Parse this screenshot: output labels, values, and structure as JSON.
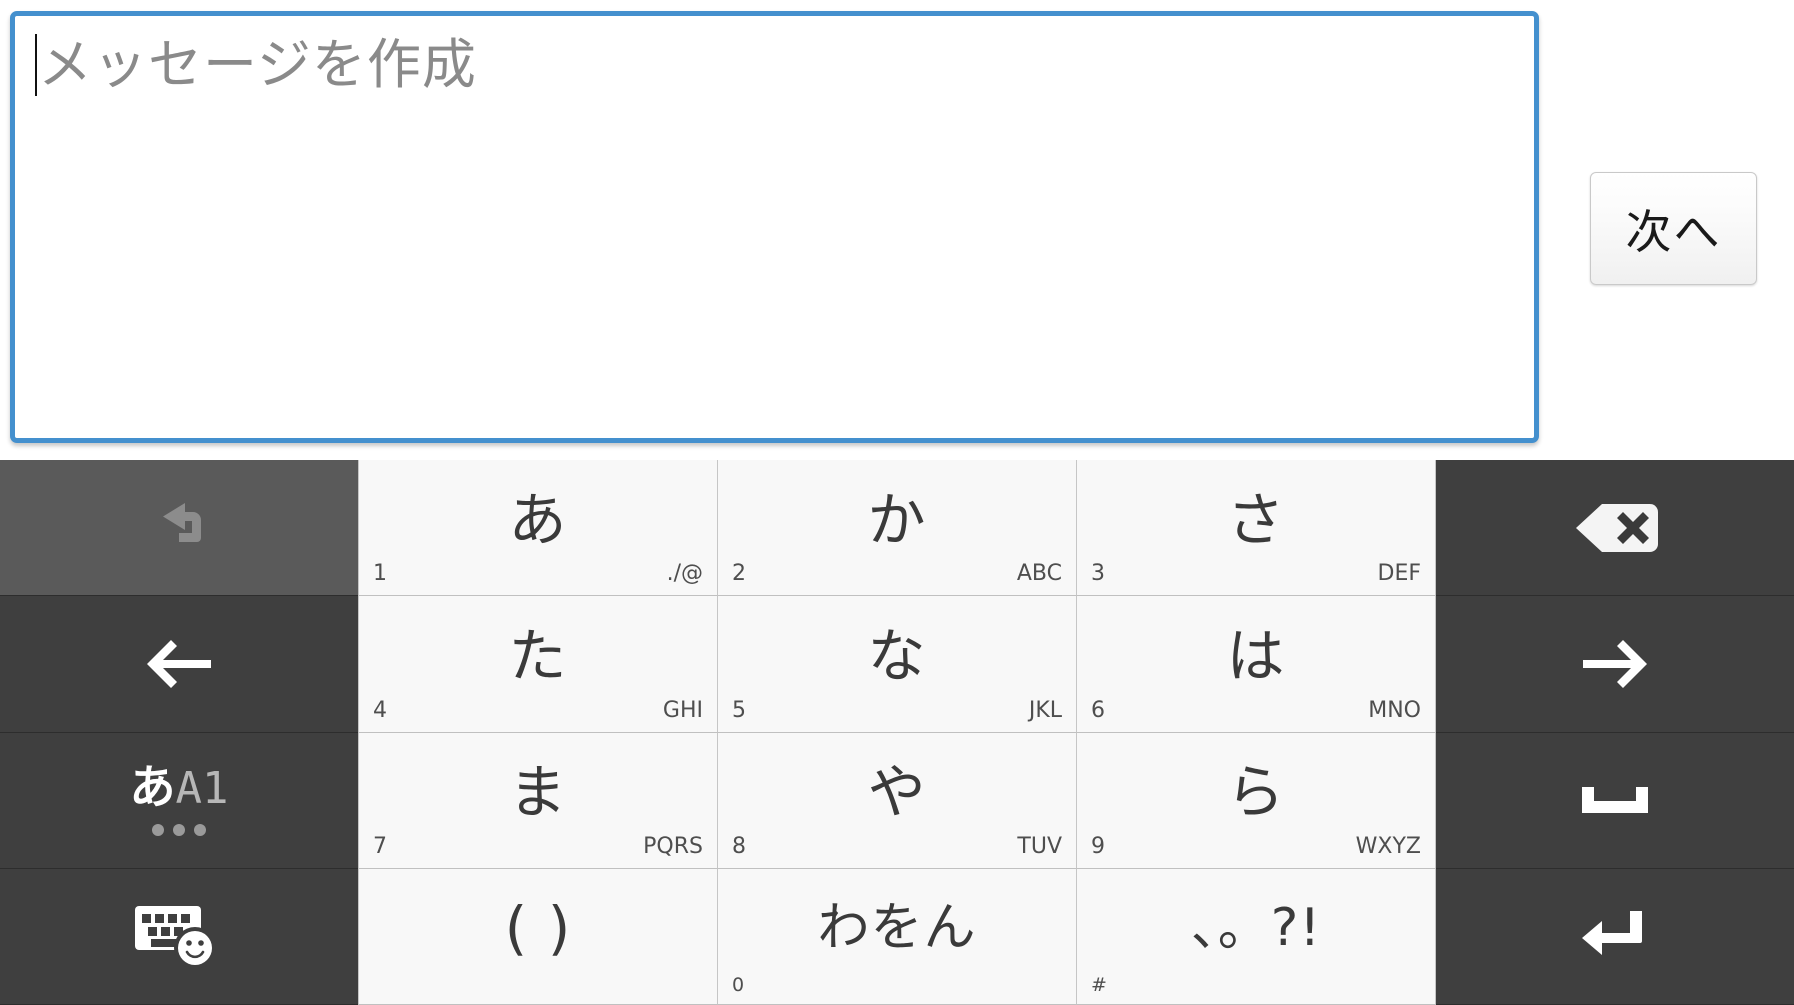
{
  "compose": {
    "placeholder": "メッセージを作成",
    "value": "",
    "border_color": "#4490ce",
    "caret_visible": true
  },
  "next_button": {
    "label": "次へ"
  },
  "keyboard": {
    "background_color": "#3f3f3f",
    "letter_key_color": "#f8f8f8",
    "rows": [
      {
        "left": {
          "name": "undo-key",
          "icon": "undo-icon",
          "label": ""
        },
        "keys": [
          {
            "glyph": "あ",
            "num": "1",
            "alpha": "./@"
          },
          {
            "glyph": "か",
            "num": "2",
            "alpha": "ABC"
          },
          {
            "glyph": "さ",
            "num": "3",
            "alpha": "DEF"
          }
        ],
        "right": {
          "name": "backspace-key",
          "icon": "backspace-icon",
          "label": ""
        }
      },
      {
        "left": {
          "name": "cursor-left-key",
          "icon": "arrow-left-icon",
          "label": ""
        },
        "keys": [
          {
            "glyph": "た",
            "num": "4",
            "alpha": "GHI"
          },
          {
            "glyph": "な",
            "num": "5",
            "alpha": "JKL"
          },
          {
            "glyph": "は",
            "num": "6",
            "alpha": "MNO"
          }
        ],
        "right": {
          "name": "cursor-right-key",
          "icon": "arrow-right-icon",
          "label": ""
        }
      },
      {
        "left": {
          "name": "input-mode-key",
          "icon": "mode-switch-icon",
          "label": "あA1"
        },
        "keys": [
          {
            "glyph": "ま",
            "num": "7",
            "alpha": "PQRS"
          },
          {
            "glyph": "や",
            "num": "8",
            "alpha": "TUV"
          },
          {
            "glyph": "ら",
            "num": "9",
            "alpha": "WXYZ"
          }
        ],
        "right": {
          "name": "space-key",
          "icon": "space-icon",
          "label": ""
        }
      },
      {
        "left": {
          "name": "keyboard-emoji-key",
          "icon": "keyboard-emoji-icon",
          "label": ""
        },
        "keys": [
          {
            "glyph": "( )",
            "num": "",
            "alpha": ""
          },
          {
            "glyph": "わをん",
            "num": "0",
            "alpha": ""
          },
          {
            "glyph": "、。?!",
            "num": "#",
            "alpha": ""
          }
        ],
        "right": {
          "name": "enter-key",
          "icon": "enter-icon",
          "label": ""
        }
      }
    ],
    "mode_key": {
      "kana": "あ",
      "alnum": "A1",
      "dots": 3
    }
  }
}
